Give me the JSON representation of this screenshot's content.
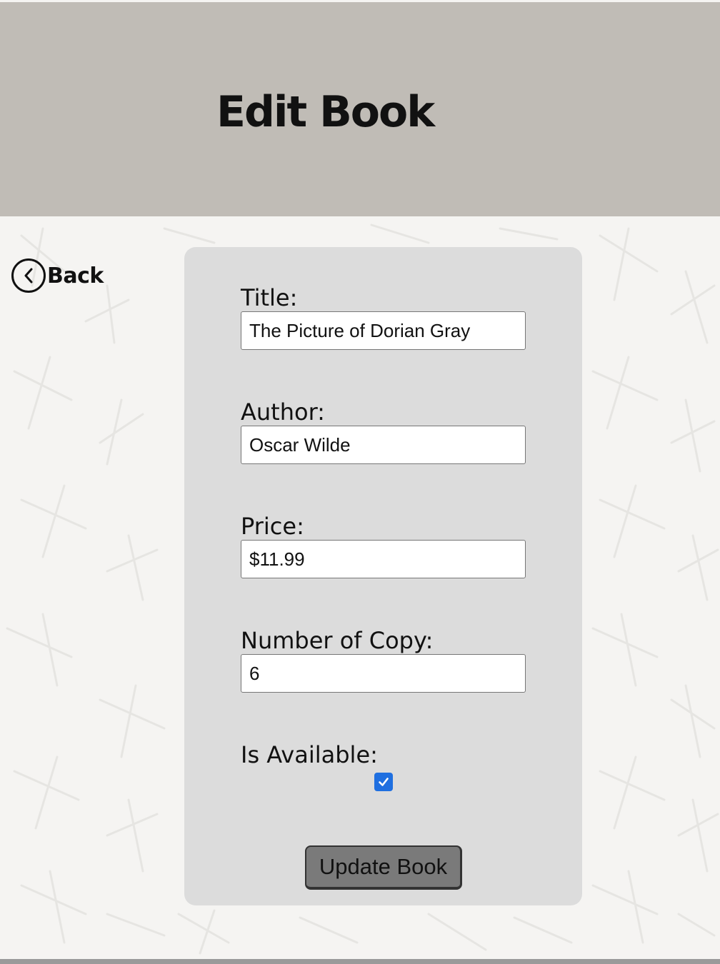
{
  "header": {
    "title": "Edit Book"
  },
  "navigation": {
    "back_label": "Back"
  },
  "form": {
    "title": {
      "label": "Title:",
      "value": "The Picture of Dorian Gray"
    },
    "author": {
      "label": "Author:",
      "value": "Oscar Wilde"
    },
    "price": {
      "label": "Price:",
      "value": "$11.99"
    },
    "copies": {
      "label": "Number of Copy:",
      "value": "6"
    },
    "available": {
      "label": "Is Available:",
      "checked": true
    },
    "submit_label": "Update Book"
  },
  "icons": {
    "back": "chevron-left-circle-icon",
    "checkbox": "checkmark-icon"
  },
  "colors": {
    "header_bg": "#c0bcb6",
    "card_bg": "#dcdcdc",
    "page_bg": "#f5f4f2",
    "button_bg": "#7a7a7a",
    "checkbox_accent": "#1f6fe0"
  }
}
